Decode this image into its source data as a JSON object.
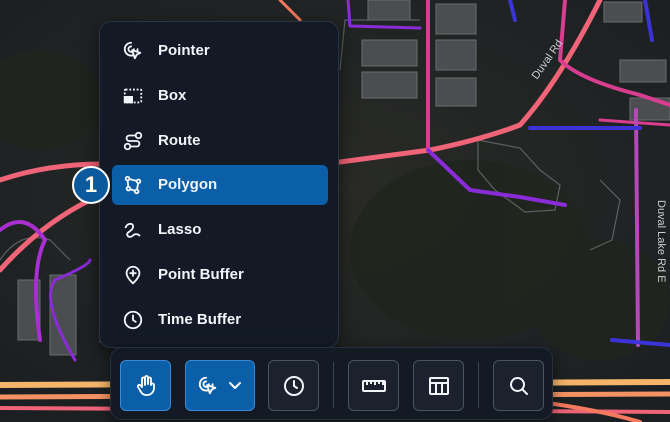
{
  "menu": {
    "items": [
      {
        "label": "Pointer",
        "icon": "pointer-icon"
      },
      {
        "label": "Box",
        "icon": "box-select-icon"
      },
      {
        "label": "Route",
        "icon": "route-icon"
      },
      {
        "label": "Polygon",
        "icon": "polygon-icon",
        "selected": true
      },
      {
        "label": "Lasso",
        "icon": "lasso-icon"
      },
      {
        "label": "Point Buffer",
        "icon": "point-buffer-icon"
      },
      {
        "label": "Time Buffer",
        "icon": "time-buffer-icon"
      }
    ]
  },
  "callout": {
    "number": "1"
  },
  "map": {
    "labels": {
      "road_1": "Duval Rd",
      "road_2": "Duval Lake Rd E"
    }
  },
  "toolbar": {
    "buttons": [
      {
        "icon": "hand-pan-icon",
        "active": true
      },
      {
        "icon": "select-tool-icon",
        "dropdown_icon": "chevron-down-icon",
        "active": true
      },
      {
        "icon": "clock-icon"
      },
      {
        "icon": "ruler-icon"
      },
      {
        "icon": "table-icon"
      },
      {
        "icon": "search-icon"
      }
    ]
  },
  "colors": {
    "menu_bg": "#131a26",
    "selected": "#0a5fa8",
    "road_orange": "#f47a5f",
    "road_pink": "#d93d8f",
    "road_purple": "#8a2bd8",
    "road_blue": "#3b33d6"
  }
}
